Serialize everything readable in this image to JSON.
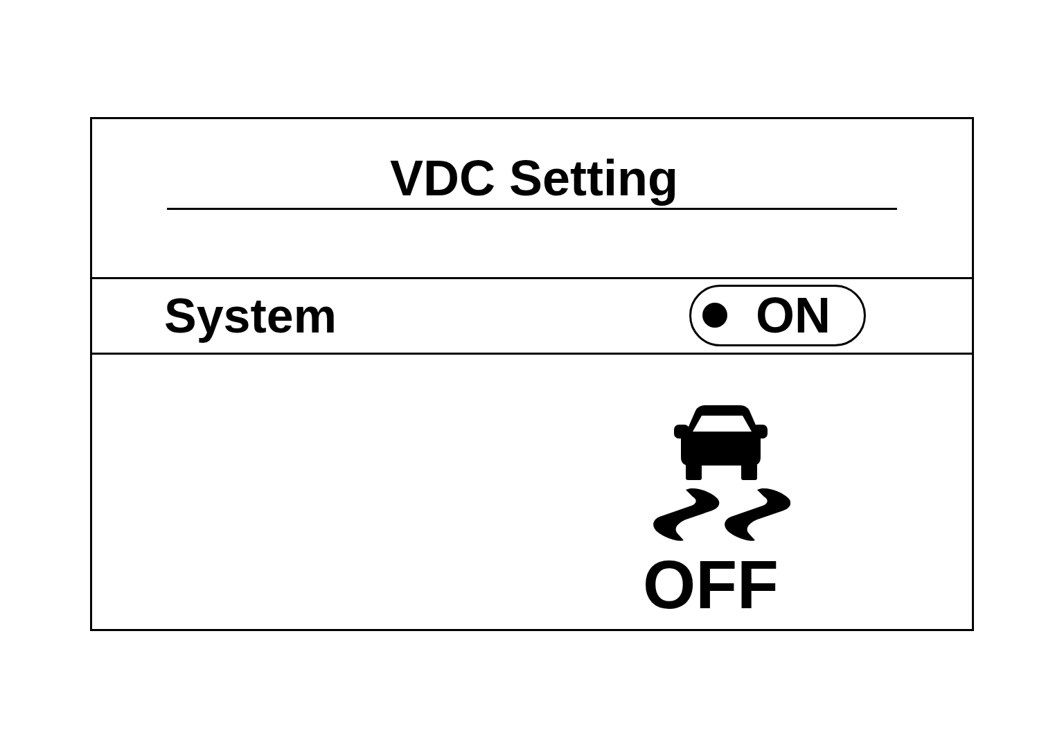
{
  "screen": {
    "title": "VDC Setting"
  },
  "settings": [
    {
      "label": "System",
      "options": [
        {
          "label": "ON",
          "selected": true
        }
      ]
    }
  ],
  "indicator": {
    "label": "OFF"
  }
}
